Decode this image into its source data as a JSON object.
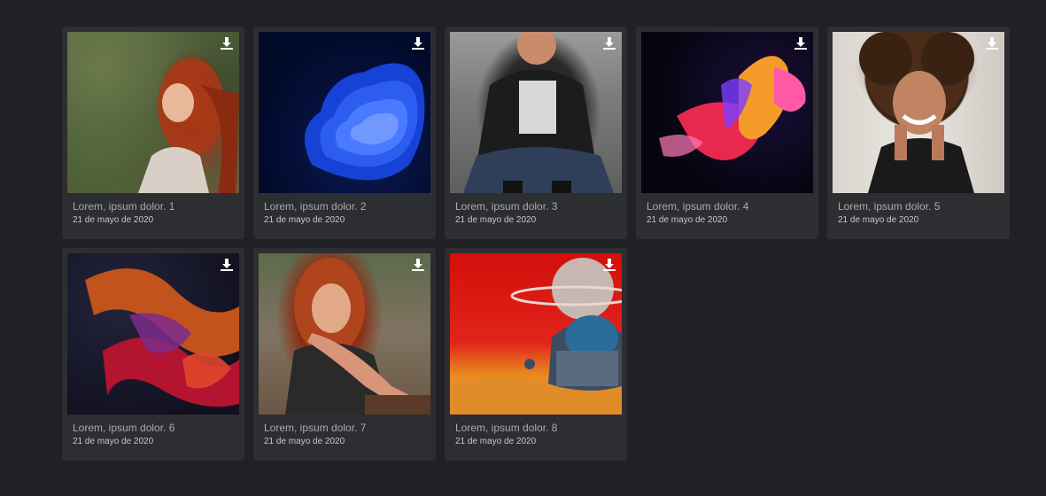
{
  "gallery": {
    "items": [
      {
        "title": "Lorem, ipsum dolor. 1",
        "date": "21 de mayo de 2020"
      },
      {
        "title": "Lorem, ipsum dolor. 2",
        "date": "21 de mayo de 2020"
      },
      {
        "title": "Lorem, ipsum dolor. 3",
        "date": "21 de mayo de 2020"
      },
      {
        "title": "Lorem, ipsum dolor. 4",
        "date": "21 de mayo de 2020"
      },
      {
        "title": "Lorem, ipsum dolor. 5",
        "date": "21 de mayo de 2020"
      },
      {
        "title": "Lorem, ipsum dolor. 6",
        "date": "21 de mayo de 2020"
      },
      {
        "title": "Lorem, ipsum dolor. 7",
        "date": "21 de mayo de 2020"
      },
      {
        "title": "Lorem, ipsum dolor. 8",
        "date": "21 de mayo de 2020"
      }
    ],
    "icon": "download-icon"
  },
  "colors": {
    "background": "#202124",
    "card": "#2d2e31",
    "title_text": "#a9aaac",
    "date_text": "#c6c7c9"
  }
}
